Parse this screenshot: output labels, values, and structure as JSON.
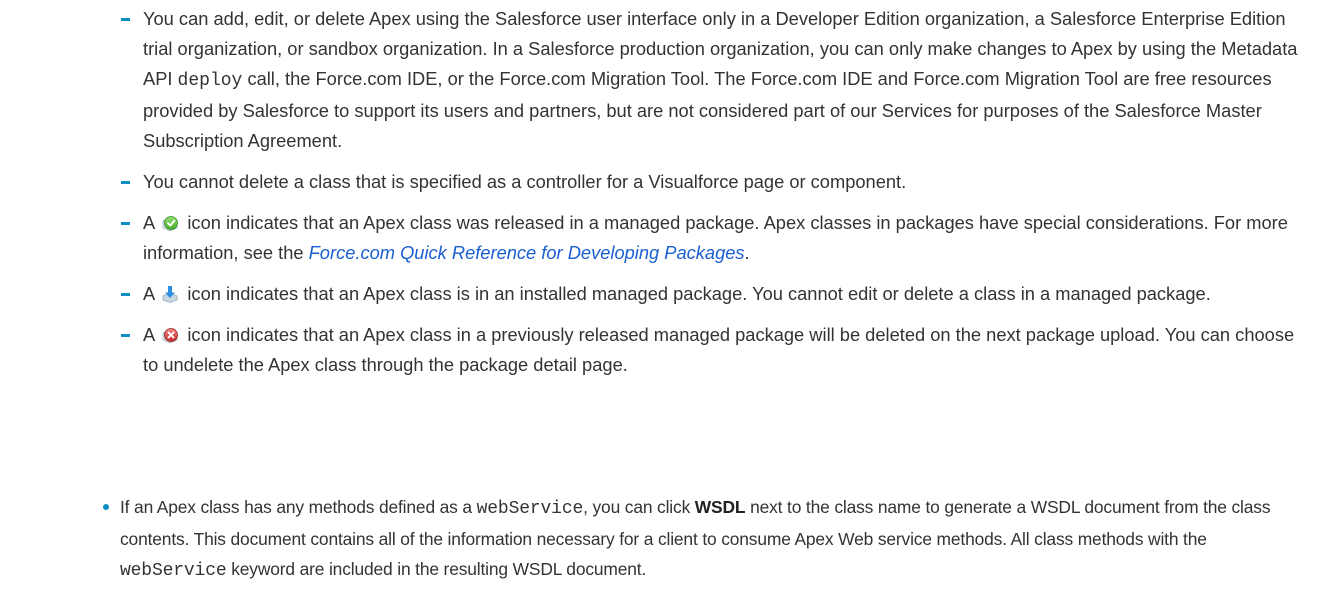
{
  "notes": {
    "apex_editing": {
      "text_1": "You can add, edit, or delete Apex using the Salesforce user interface only in a Developer Edition organization, a Salesforce Enterprise Edition trial organization, or sandbox organization. In a Salesforce production organization, you can only make changes to Apex by using the Metadata API ",
      "code": "deploy",
      "text_2": " call, the Force.com IDE, or the Force.com Migration Tool. The Force.com IDE and Force.com Migration Tool are free resources provided by Salesforce to support its users and partners, but are not considered part of our Services for purposes of the Salesforce Master Subscription Agreement."
    },
    "controller_delete": {
      "text": "You cannot delete a class that is specified as a controller for a Visualforce page or component."
    },
    "released_icon": {
      "prefix": "A",
      "icon_name": "managed-package-released-icon",
      "text_1": " icon indicates that an Apex class was released in a managed package. Apex classes in packages have special considerations. For more information, see the ",
      "link": "Force.com Quick Reference for Developing Packages",
      "text_2": "."
    },
    "installed_icon": {
      "prefix": "A",
      "icon_name": "installed-managed-package-icon",
      "text": " icon indicates that an Apex class is in an installed managed package. You cannot edit or delete a class in a managed package."
    },
    "deleted_icon": {
      "prefix": "A",
      "icon_name": "deleted-managed-package-icon",
      "text": " icon indicates that an Apex class in a previously released managed package will be deleted on the next package upload. You can choose to undelete the Apex class through the package detail page."
    }
  },
  "wsdl_bullet": {
    "text_1": "If an Apex class has any methods defined as a ",
    "code_1": "webService",
    "text_2": ", you can click ",
    "bold": "WSDL",
    "text_3": " next to the class name to generate a WSDL document from the class contents. This document contains all of the information necessary for a client to consume Apex Web service methods. All class methods with the ",
    "code_2": "webService",
    "text_4": " keyword are included in the resulting WSDL document."
  },
  "colors": {
    "body_text": "#333333",
    "accent": "#0c8fc5",
    "link": "#1a5fd1"
  }
}
